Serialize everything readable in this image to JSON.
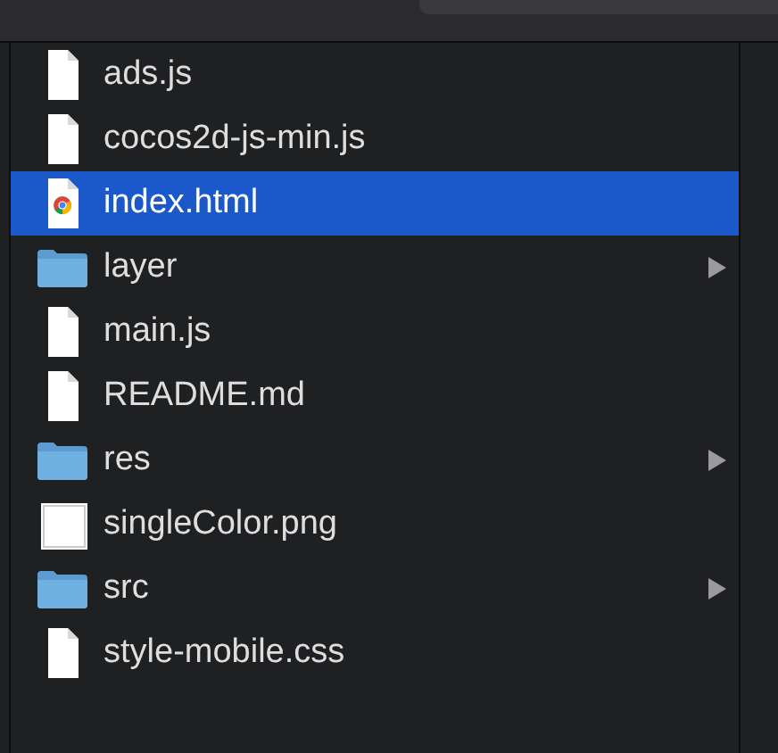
{
  "files": [
    {
      "name": "ads.js",
      "kind": "document",
      "selected": false
    },
    {
      "name": "cocos2d-js-min.js",
      "kind": "document",
      "selected": false
    },
    {
      "name": "index.html",
      "kind": "web-page",
      "selected": true
    },
    {
      "name": "layer",
      "kind": "folder",
      "selected": false
    },
    {
      "name": "main.js",
      "kind": "document",
      "selected": false
    },
    {
      "name": "README.md",
      "kind": "document",
      "selected": false
    },
    {
      "name": "res",
      "kind": "folder",
      "selected": false
    },
    {
      "name": "singleColor.png",
      "kind": "image",
      "selected": false
    },
    {
      "name": "src",
      "kind": "folder",
      "selected": false
    },
    {
      "name": "style-mobile.css",
      "kind": "document",
      "selected": false
    }
  ]
}
